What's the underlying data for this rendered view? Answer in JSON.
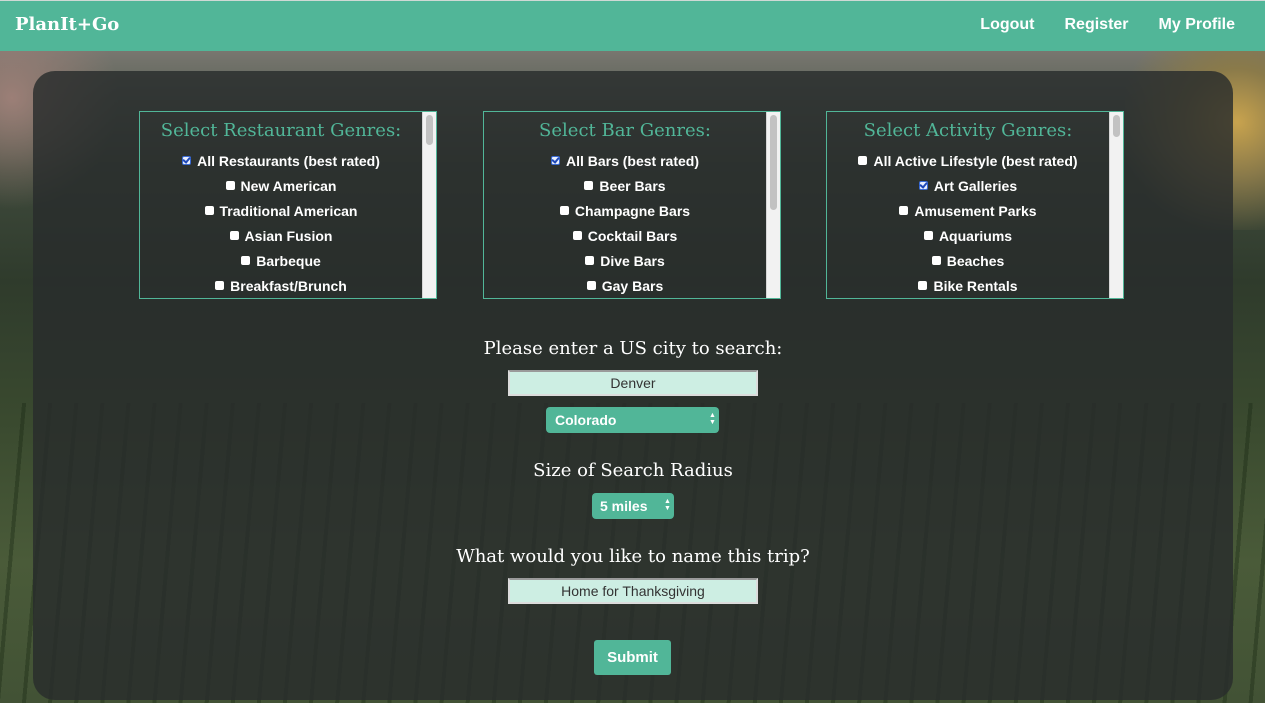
{
  "brand": "PlanIt+Go",
  "nav": {
    "logout": "Logout",
    "register": "Register",
    "profile": "My Profile"
  },
  "restaurant": {
    "title": "Select Restaurant Genres:",
    "items": [
      {
        "label": "All Restaurants (best rated)",
        "checked": true
      },
      {
        "label": "New American",
        "checked": false
      },
      {
        "label": "Traditional American",
        "checked": false
      },
      {
        "label": "Asian Fusion",
        "checked": false
      },
      {
        "label": "Barbeque",
        "checked": false
      },
      {
        "label": "Breakfast/Brunch",
        "checked": false
      }
    ]
  },
  "bar": {
    "title": "Select Bar Genres:",
    "items": [
      {
        "label": "All Bars (best rated)",
        "checked": true
      },
      {
        "label": "Beer Bars",
        "checked": false
      },
      {
        "label": "Champagne Bars",
        "checked": false
      },
      {
        "label": "Cocktail Bars",
        "checked": false
      },
      {
        "label": "Dive Bars",
        "checked": false
      },
      {
        "label": "Gay Bars",
        "checked": false
      }
    ]
  },
  "activity": {
    "title": "Select Activity Genres:",
    "items": [
      {
        "label": "All Active Lifestyle (best rated)",
        "checked": false
      },
      {
        "label": "Art Galleries",
        "checked": true
      },
      {
        "label": "Amusement Parks",
        "checked": false
      },
      {
        "label": "Aquariums",
        "checked": false
      },
      {
        "label": "Beaches",
        "checked": false
      },
      {
        "label": "Bike Rentals",
        "checked": false
      }
    ]
  },
  "city": {
    "label": "Please enter a US city to search:",
    "value": "Denver"
  },
  "state": {
    "value": "Colorado"
  },
  "radius": {
    "label": "Size of Search Radius",
    "value": "5 miles"
  },
  "trip": {
    "label": "What would you like to name this trip?",
    "value": "Home for Thanksgiving"
  },
  "submit_label": "Submit",
  "colors": {
    "accent": "#51b698",
    "input_bg": "#cdeee3",
    "panel": "#2b2f2f"
  }
}
